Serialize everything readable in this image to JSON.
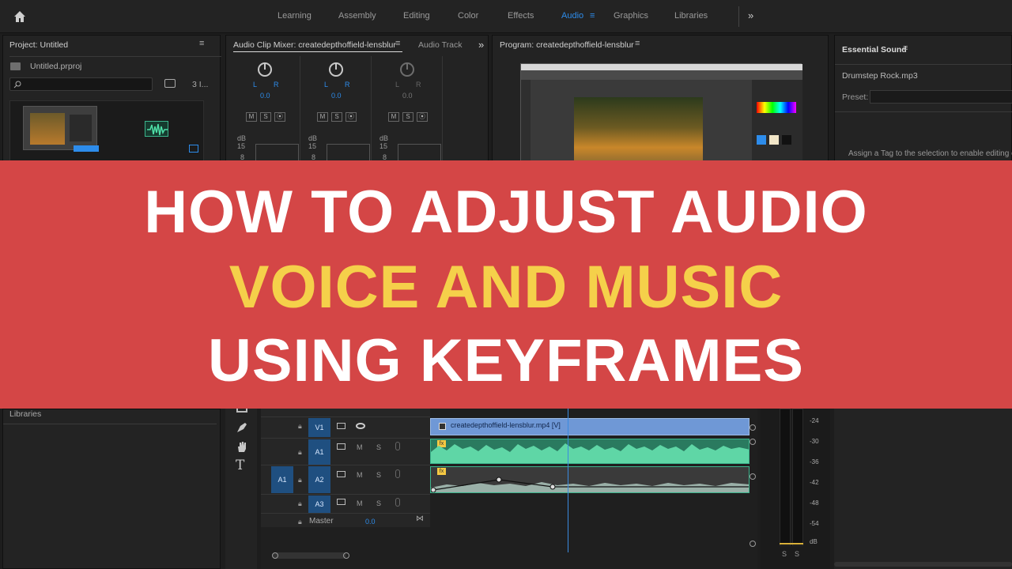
{
  "workspaces": {
    "tabs": [
      "Learning",
      "Assembly",
      "Editing",
      "Color",
      "Effects",
      "Audio",
      "Graphics",
      "Libraries"
    ],
    "active": "Audio",
    "more": "»"
  },
  "project": {
    "title": "Project: Untitled",
    "file": "Untitled.prproj",
    "count": "3 I..."
  },
  "mixer": {
    "title": "Audio Clip Mixer: createdepthoffield-lensblur",
    "tab2": "Audio Track",
    "more": "»",
    "channels": [
      {
        "pan_l": "L",
        "pan_r": "R",
        "value": "0.0",
        "m": "M",
        "s": "S",
        "r": "⦿"
      },
      {
        "pan_l": "L",
        "pan_r": "R",
        "value": "0.0",
        "m": "M",
        "s": "S",
        "r": "⦿"
      },
      {
        "pan_l": "L",
        "pan_r": "R",
        "value": "0.0",
        "m": "M",
        "s": "S",
        "r": "⦿"
      }
    ],
    "db_label": "dB",
    "db_15": "15",
    "db_8": "8"
  },
  "program": {
    "title": "Program: createdepthoffield-lensblur"
  },
  "essential_sound": {
    "title": "Essential Sound",
    "clip": "Drumstep Rock.mp3",
    "preset_label": "Preset:",
    "hint": "Assign a Tag to the selection to enable editing o"
  },
  "banner": {
    "line1": "HOW TO ADJUST AUDIO",
    "line2": "VOICE AND MUSIC",
    "line3": "USING KEYFRAMES",
    "line1_color": "#ffffff",
    "line2_color": "#f5d04a",
    "line3_color": "#ffffff",
    "bg_color": "#d44646"
  },
  "libraries": {
    "label": "Libraries"
  },
  "timeline": {
    "tracks": [
      {
        "label": "V1",
        "type": "video"
      },
      {
        "label": "A1",
        "type": "audio"
      },
      {
        "label": "A2",
        "type": "audio"
      },
      {
        "label": "A3",
        "type": "audio"
      }
    ],
    "source_label": "A1",
    "master_label": "Master",
    "master_value": "0.0",
    "video_clip": "createdepthoffield-lensblur.mp4 [V]",
    "fx_badge": "fx",
    "m": "M",
    "s": "S"
  },
  "meter": {
    "labels": [
      "-24",
      "-30",
      "-36",
      "-42",
      "-48",
      "-54",
      "dB"
    ],
    "solo_l": "S",
    "solo_r": "S"
  },
  "colors": {
    "accent": "#2d8ceb",
    "track_selected": "#1f4f80",
    "audio_clip": "#3bb48c",
    "video_clip": "#6f98d6"
  }
}
